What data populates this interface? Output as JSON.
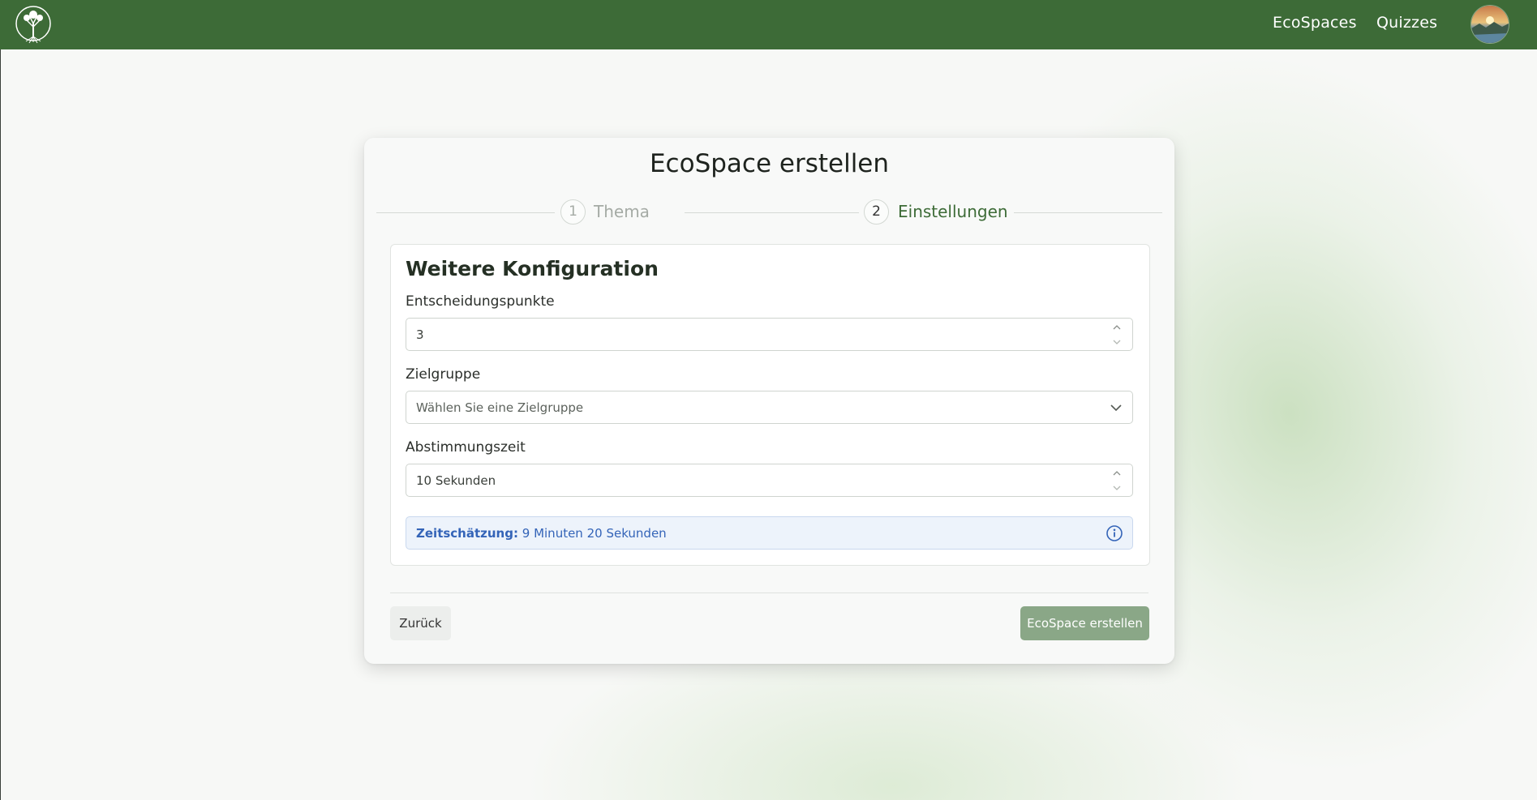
{
  "theme": {
    "nav_bg": "#3d6b37",
    "accent": "#3d6b37",
    "info_text": "#3464b8",
    "disabled_button": "#8aa787"
  },
  "nav": {
    "logo": "tree-logo",
    "links": [
      "EcoSpaces",
      "Quizzes"
    ],
    "avatar": "user-avatar"
  },
  "card": {
    "title": "EcoSpace erstellen",
    "steps": [
      {
        "number": "1",
        "label": "Thema",
        "active": false
      },
      {
        "number": "2",
        "label": "Einstellungen",
        "active": true
      }
    ],
    "section_title": "Weitere Konfiguration",
    "fields": {
      "decision_points": {
        "label": "Entscheidungspunkte",
        "value": "3"
      },
      "target_group": {
        "label": "Zielgruppe",
        "placeholder": "Wählen Sie eine Zielgruppe"
      },
      "voting_time": {
        "label": "Abstimmungszeit",
        "value": "10 Sekunden"
      }
    },
    "estimate": {
      "label": "Zeitschätzung:",
      "value": "9 Minuten 20 Sekunden",
      "icon": "info-icon"
    },
    "buttons": {
      "back": "Zurück",
      "create": "EcoSpace erstellen"
    }
  }
}
